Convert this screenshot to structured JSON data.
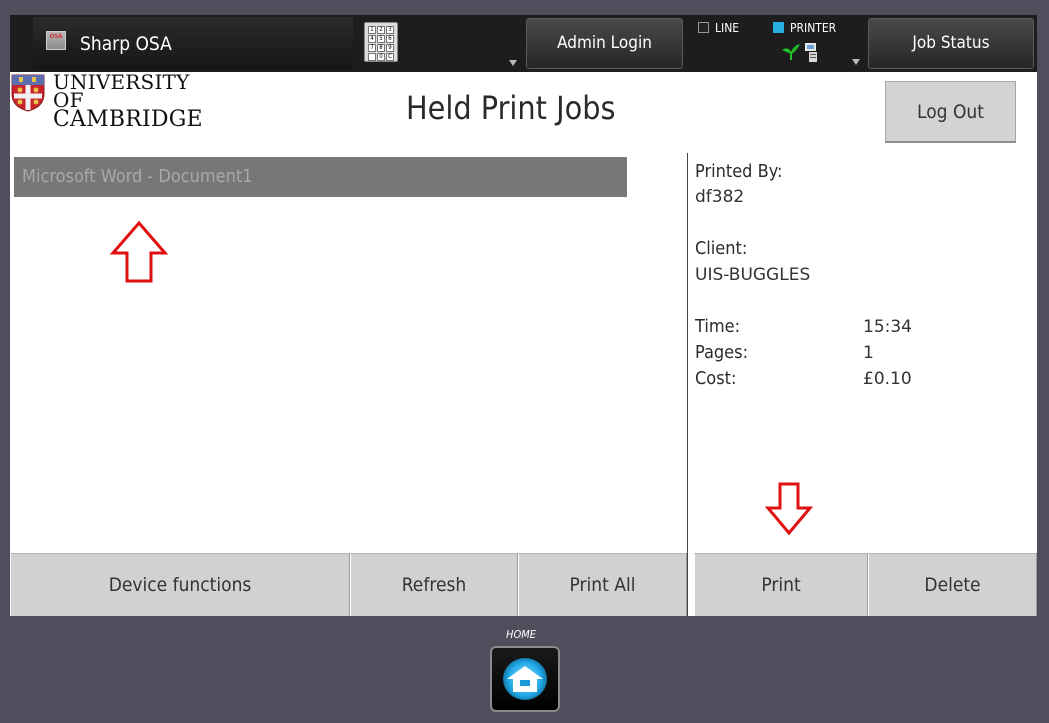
{
  "topbar": {
    "app_title": "Sharp OSA",
    "osa_icon_text": "OSA",
    "keypad_keys": [
      "1",
      "2",
      "3",
      "4",
      "5",
      "6",
      "7",
      "8",
      "9",
      "",
      "0",
      "C"
    ],
    "admin_login": "Admin Login",
    "line_label": "LINE",
    "printer_label": "PRINTER",
    "job_status": "Job Status"
  },
  "logo": {
    "line1": "UNIVERSITY OF",
    "line2": "CAMBRIDGE"
  },
  "page_title": "Held Print Jobs",
  "logout_label": "Log Out",
  "jobs": [
    {
      "name": "Microsoft Word - Document1"
    }
  ],
  "details": {
    "printed_by_label": "Printed By:",
    "printed_by_value": "df382",
    "client_label": "Client:",
    "client_value": "UIS-BUGGLES",
    "time_label": "Time:",
    "time_value": "15:34",
    "pages_label": "Pages:",
    "pages_value": "1",
    "cost_label": "Cost:",
    "cost_value": "£0.10"
  },
  "buttons": {
    "device_functions": "Device functions",
    "refresh": "Refresh",
    "print_all": "Print All",
    "print": "Print",
    "delete": "Delete"
  },
  "home_label": "HOME",
  "colors": {
    "annotation_arrow": "#e01010",
    "status_on": "#27aee0"
  },
  "icons": [
    "osa-icon",
    "keypad-icon",
    "printer-status-icon",
    "crest-icon",
    "up-arrow-annotation",
    "down-arrow-annotation",
    "home-icon"
  ]
}
